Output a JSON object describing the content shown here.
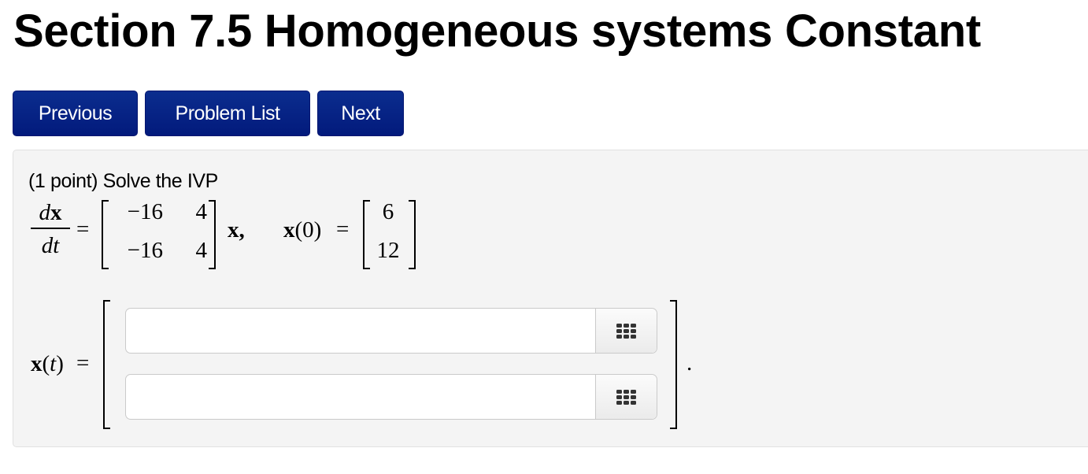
{
  "page_title": "Section 7.5 Homogeneous systems Constant",
  "nav": {
    "previous_label": "Previous",
    "problem_list_label": "Problem List",
    "next_label": "Next"
  },
  "colors": {
    "button_bg": "#0b2d8e",
    "panel_bg": "#f4f4f4"
  },
  "problem": {
    "prompt": "(1 point) Solve the IVP",
    "lhs_num": "dx",
    "lhs_den": "dt",
    "equals": "=",
    "matrix": [
      [
        "−16",
        "4"
      ],
      [
        "−16",
        "4"
      ]
    ],
    "after_matrix": "x,",
    "ic_label": "x(0)",
    "initial_vector": [
      "6",
      "12"
    ],
    "answer_label": "x(t)",
    "answer_inputs": [
      {
        "value": "",
        "placeholder": ""
      },
      {
        "value": "",
        "placeholder": ""
      }
    ],
    "palette_icon": "grid-icon",
    "trailing_period": "."
  }
}
